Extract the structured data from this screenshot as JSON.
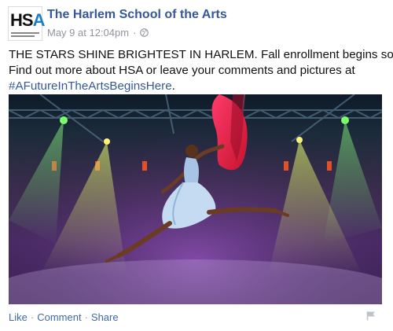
{
  "header": {
    "page_name": "The Harlem School of the Arts",
    "timestamp": "May 9 at 12:04pm",
    "separator": "·",
    "privacy_icon": "globe-icon",
    "avatar_logo": "HSA"
  },
  "post": {
    "line1": "THE STARS SHINE BRIGHTEST IN HARLEM. Fall enrollment begins soon.",
    "line2": "Find out more about HSA or leave your comments and pictures at",
    "hashtag": "#AFutureInTheArtsBeginsHere",
    "hashtag_suffix": "."
  },
  "photo": {
    "subject": "dancer-leaping-on-stage"
  },
  "footer": {
    "like_label": "Like",
    "comment_label": "Comment",
    "share_label": "Share",
    "separator": "·",
    "flag_icon": "flag-icon"
  },
  "colors": {
    "link": "#365899",
    "meta": "#90949c",
    "action": "#4267b2",
    "text": "#1d2129"
  }
}
